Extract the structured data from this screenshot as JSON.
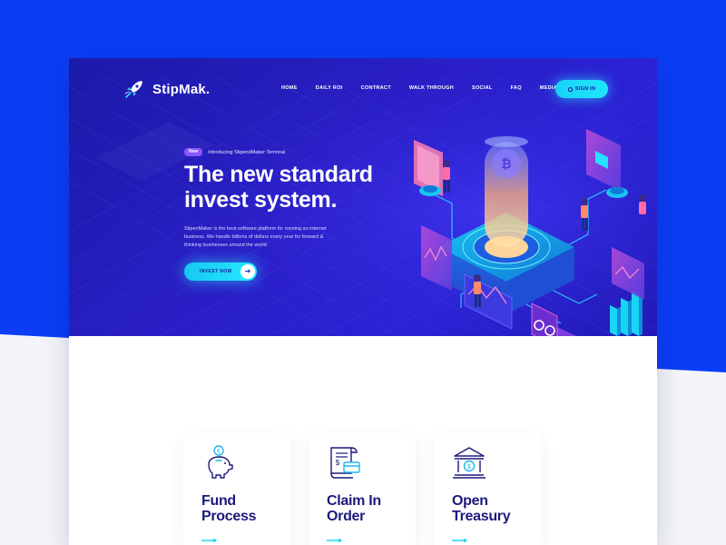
{
  "brand": {
    "name": "StipMak.",
    "logo_icon": "rocket-icon"
  },
  "nav": {
    "items": [
      "HOME",
      "DAILY ROI",
      "CONTRACT",
      "WALK THROUGH",
      "SOCIAL",
      "FAQ",
      "MEDIA KIT"
    ],
    "signin_label": "SIGN IN",
    "signin_icon": "user-icon"
  },
  "hero": {
    "badge": "New",
    "announcement": "Introducing StipendMaker Terminal",
    "headline_line1": "The new standard",
    "headline_line2": "invest system.",
    "description": "StipenMaker is the best software platform for running an internet business. We handle billions of dollars every year for forward & thinking businesses around the world.",
    "cta_label": "INVEST NOW",
    "cta_icon": "arrow-right-icon"
  },
  "features": [
    {
      "title_line1": "Fund",
      "title_line2": "Process",
      "icon": "piggy-bank-icon"
    },
    {
      "title_line1": "Claim In",
      "title_line2": "Order",
      "icon": "receipt-icon"
    },
    {
      "title_line1": "Open",
      "title_line2": "Treasury",
      "icon": "bank-icon"
    }
  ],
  "colors": {
    "page_blue": "#0b3df5",
    "hero_gradient": [
      "#1b1aa8",
      "#2a23d6"
    ],
    "accent_cyan": "#20e6ff",
    "badge_purple": "#8a55ff",
    "heading_navy": "#1b1a7a"
  }
}
